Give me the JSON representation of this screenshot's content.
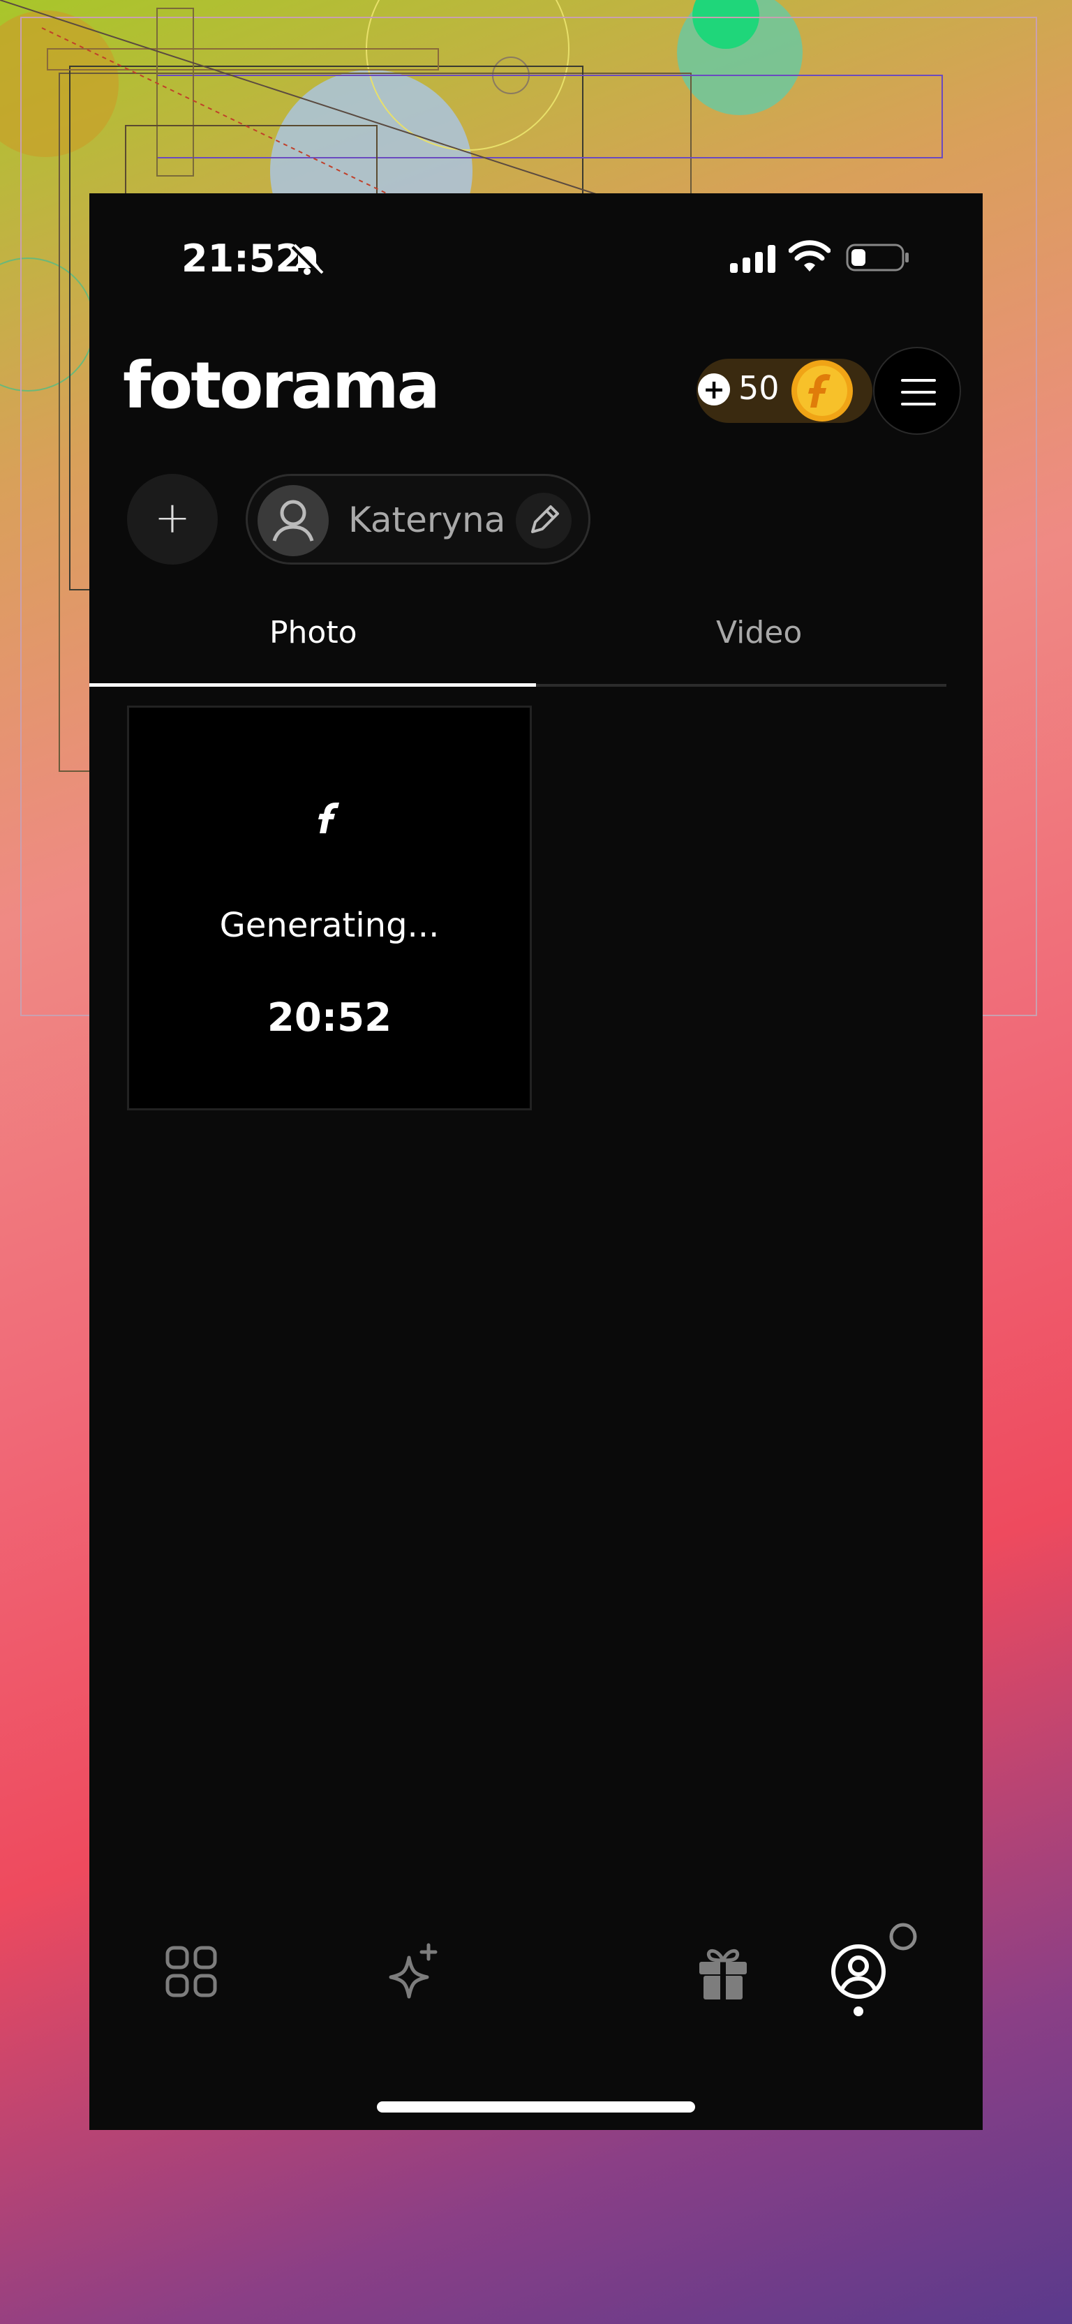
{
  "status_bar": {
    "time": "21:52"
  },
  "header": {
    "logo": "fotorama",
    "credits": "50"
  },
  "profile": {
    "add_label": "+",
    "name": "Kateryna"
  },
  "tabs": [
    {
      "label": "Photo",
      "active": true
    },
    {
      "label": "Video",
      "active": false
    }
  ],
  "gallery": {
    "items": [
      {
        "status": "Generating...",
        "timer": "20:52"
      }
    ]
  },
  "bottom_nav": {
    "items": [
      "grid-icon",
      "sparkle-icon",
      "gift-icon",
      "profile-icon"
    ],
    "active": "profile-icon"
  },
  "colors": {
    "app_background": "#0a0a0a",
    "coin_gold": "#f5b31a",
    "credit_pill": "#3a2a10"
  }
}
